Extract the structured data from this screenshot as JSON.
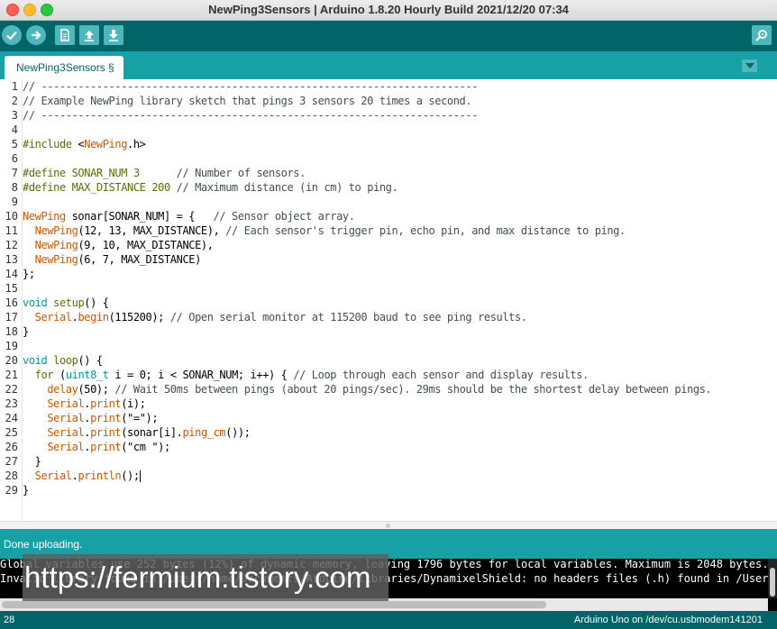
{
  "window": {
    "title": "NewPing3Sensors | Arduino 1.8.20 Hourly Build 2021/12/20 07:34"
  },
  "toolbar": {
    "buttons": [
      {
        "name": "verify",
        "icon": "check-icon"
      },
      {
        "name": "upload",
        "icon": "arrow-right-icon"
      },
      {
        "name": "new",
        "icon": "document-icon"
      },
      {
        "name": "open",
        "icon": "arrow-up-icon"
      },
      {
        "name": "save",
        "icon": "arrow-down-icon"
      }
    ],
    "serial_monitor_icon": "magnifier-icon"
  },
  "tabs": [
    {
      "label": "NewPing3Sensors §"
    }
  ],
  "editor": {
    "line_numbers": [
      "1",
      "2",
      "3",
      "4",
      "5",
      "6",
      "7",
      "8",
      "9",
      "10",
      "11",
      "12",
      "13",
      "14",
      "15",
      "16",
      "17",
      "18",
      "19",
      "20",
      "21",
      "22",
      "23",
      "24",
      "25",
      "26",
      "27",
      "28",
      "29"
    ],
    "lines": [
      [
        {
          "t": "// -----------------------------------------------------------------------",
          "c": "#434f54"
        }
      ],
      [
        {
          "t": "// Example NewPing library sketch that pings 3 sensors 20 times a second.",
          "c": "#434f54"
        }
      ],
      [
        {
          "t": "// -----------------------------------------------------------------------",
          "c": "#434f54"
        }
      ],
      [],
      [
        {
          "t": "#include ",
          "c": "#5e6d03"
        },
        {
          "t": "<",
          "c": "#000000"
        },
        {
          "t": "NewPing",
          "c": "#d35400"
        },
        {
          "t": ".h>",
          "c": "#000000"
        }
      ],
      [],
      [
        {
          "t": "#define SONAR_NUM 3      ",
          "c": "#5e6d03"
        },
        {
          "t": "// Number of sensors.",
          "c": "#434f54"
        }
      ],
      [
        {
          "t": "#define MAX_DISTANCE 200 ",
          "c": "#5e6d03"
        },
        {
          "t": "// Maximum distance (in cm) to ping.",
          "c": "#434f54"
        }
      ],
      [],
      [
        {
          "t": "NewPing",
          "c": "#d35400"
        },
        {
          "t": " sonar[SONAR_NUM] = {   ",
          "c": "#000000"
        },
        {
          "t": "// Sensor object array.",
          "c": "#434f54"
        }
      ],
      [
        {
          "t": "  ",
          "c": "#000000"
        },
        {
          "t": "NewPing",
          "c": "#d35400"
        },
        {
          "t": "(12, 13, MAX_DISTANCE), ",
          "c": "#000000"
        },
        {
          "t": "// Each sensor's trigger pin, echo pin, and max distance to ping.",
          "c": "#434f54"
        }
      ],
      [
        {
          "t": "  ",
          "c": "#000000"
        },
        {
          "t": "NewPing",
          "c": "#d35400"
        },
        {
          "t": "(9, 10, MAX_DISTANCE),",
          "c": "#000000"
        }
      ],
      [
        {
          "t": "  ",
          "c": "#000000"
        },
        {
          "t": "NewPing",
          "c": "#d35400"
        },
        {
          "t": "(6, 7, MAX_DISTANCE)",
          "c": "#000000"
        }
      ],
      [
        {
          "t": "};",
          "c": "#000000"
        }
      ],
      [],
      [
        {
          "t": "void",
          "c": "#00979c"
        },
        {
          "t": " ",
          "c": "#000000"
        },
        {
          "t": "setup",
          "c": "#5e6d03"
        },
        {
          "t": "() {",
          "c": "#000000"
        }
      ],
      [
        {
          "t": "  ",
          "c": "#000000"
        },
        {
          "t": "Serial",
          "c": "#d35400"
        },
        {
          "t": ".",
          "c": "#000000"
        },
        {
          "t": "begin",
          "c": "#d35400"
        },
        {
          "t": "(115200); ",
          "c": "#000000"
        },
        {
          "t": "// Open serial monitor at 115200 baud to see ping results.",
          "c": "#434f54"
        }
      ],
      [
        {
          "t": "}",
          "c": "#000000"
        }
      ],
      [],
      [
        {
          "t": "void",
          "c": "#00979c"
        },
        {
          "t": " ",
          "c": "#000000"
        },
        {
          "t": "loop",
          "c": "#5e6d03"
        },
        {
          "t": "() {",
          "c": "#000000"
        }
      ],
      [
        {
          "t": "  ",
          "c": "#000000"
        },
        {
          "t": "for",
          "c": "#5e6d03"
        },
        {
          "t": " (",
          "c": "#000000"
        },
        {
          "t": "uint8_t",
          "c": "#00979c"
        },
        {
          "t": " i = 0; i < SONAR_NUM; i++) { ",
          "c": "#000000"
        },
        {
          "t": "// Loop through each sensor and display results.",
          "c": "#434f54"
        }
      ],
      [
        {
          "t": "    ",
          "c": "#000000"
        },
        {
          "t": "delay",
          "c": "#d35400"
        },
        {
          "t": "(50); ",
          "c": "#000000"
        },
        {
          "t": "// Wait 50ms between pings (about 20 pings/sec). 29ms should be the shortest delay between pings.",
          "c": "#434f54"
        }
      ],
      [
        {
          "t": "    ",
          "c": "#000000"
        },
        {
          "t": "Serial",
          "c": "#d35400"
        },
        {
          "t": ".",
          "c": "#000000"
        },
        {
          "t": "print",
          "c": "#d35400"
        },
        {
          "t": "(i);",
          "c": "#000000"
        }
      ],
      [
        {
          "t": "    ",
          "c": "#000000"
        },
        {
          "t": "Serial",
          "c": "#d35400"
        },
        {
          "t": ".",
          "c": "#000000"
        },
        {
          "t": "print",
          "c": "#d35400"
        },
        {
          "t": "(\"=\");",
          "c": "#000000"
        }
      ],
      [
        {
          "t": "    ",
          "c": "#000000"
        },
        {
          "t": "Serial",
          "c": "#d35400"
        },
        {
          "t": ".",
          "c": "#000000"
        },
        {
          "t": "print",
          "c": "#d35400"
        },
        {
          "t": "(sonar[i].",
          "c": "#000000"
        },
        {
          "t": "ping_cm",
          "c": "#d35400"
        },
        {
          "t": "());",
          "c": "#000000"
        }
      ],
      [
        {
          "t": "    ",
          "c": "#000000"
        },
        {
          "t": "Serial",
          "c": "#d35400"
        },
        {
          "t": ".",
          "c": "#000000"
        },
        {
          "t": "print",
          "c": "#d35400"
        },
        {
          "t": "(\"cm \");",
          "c": "#000000"
        }
      ],
      [
        {
          "t": "  }",
          "c": "#000000"
        }
      ],
      [
        {
          "t": "  ",
          "c": "#000000"
        },
        {
          "t": "Serial",
          "c": "#d35400"
        },
        {
          "t": ".",
          "c": "#000000"
        },
        {
          "t": "println",
          "c": "#d35400"
        },
        {
          "t": "();",
          "c": "#000000"
        },
        {
          "caret": true
        }
      ],
      [
        {
          "t": "}",
          "c": "#000000"
        }
      ]
    ]
  },
  "status": {
    "message": "Done uploading."
  },
  "console": {
    "lines": [
      "Global variables use 252 bytes (12%) of dynamic memory, leaving 1796 bytes for local variables. Maximum is 2048 bytes.",
      "Invalid library found in /Users/name/Documents/Arduino/libraries/DynamixelShield: no headers files (.h) found in /Users/name/"
    ]
  },
  "watermark": {
    "text": "https://fermium.tistory.com"
  },
  "bottom": {
    "line_number": "28",
    "board_port": "Arduino Uno on /dev/cu.usbmodem141201"
  }
}
